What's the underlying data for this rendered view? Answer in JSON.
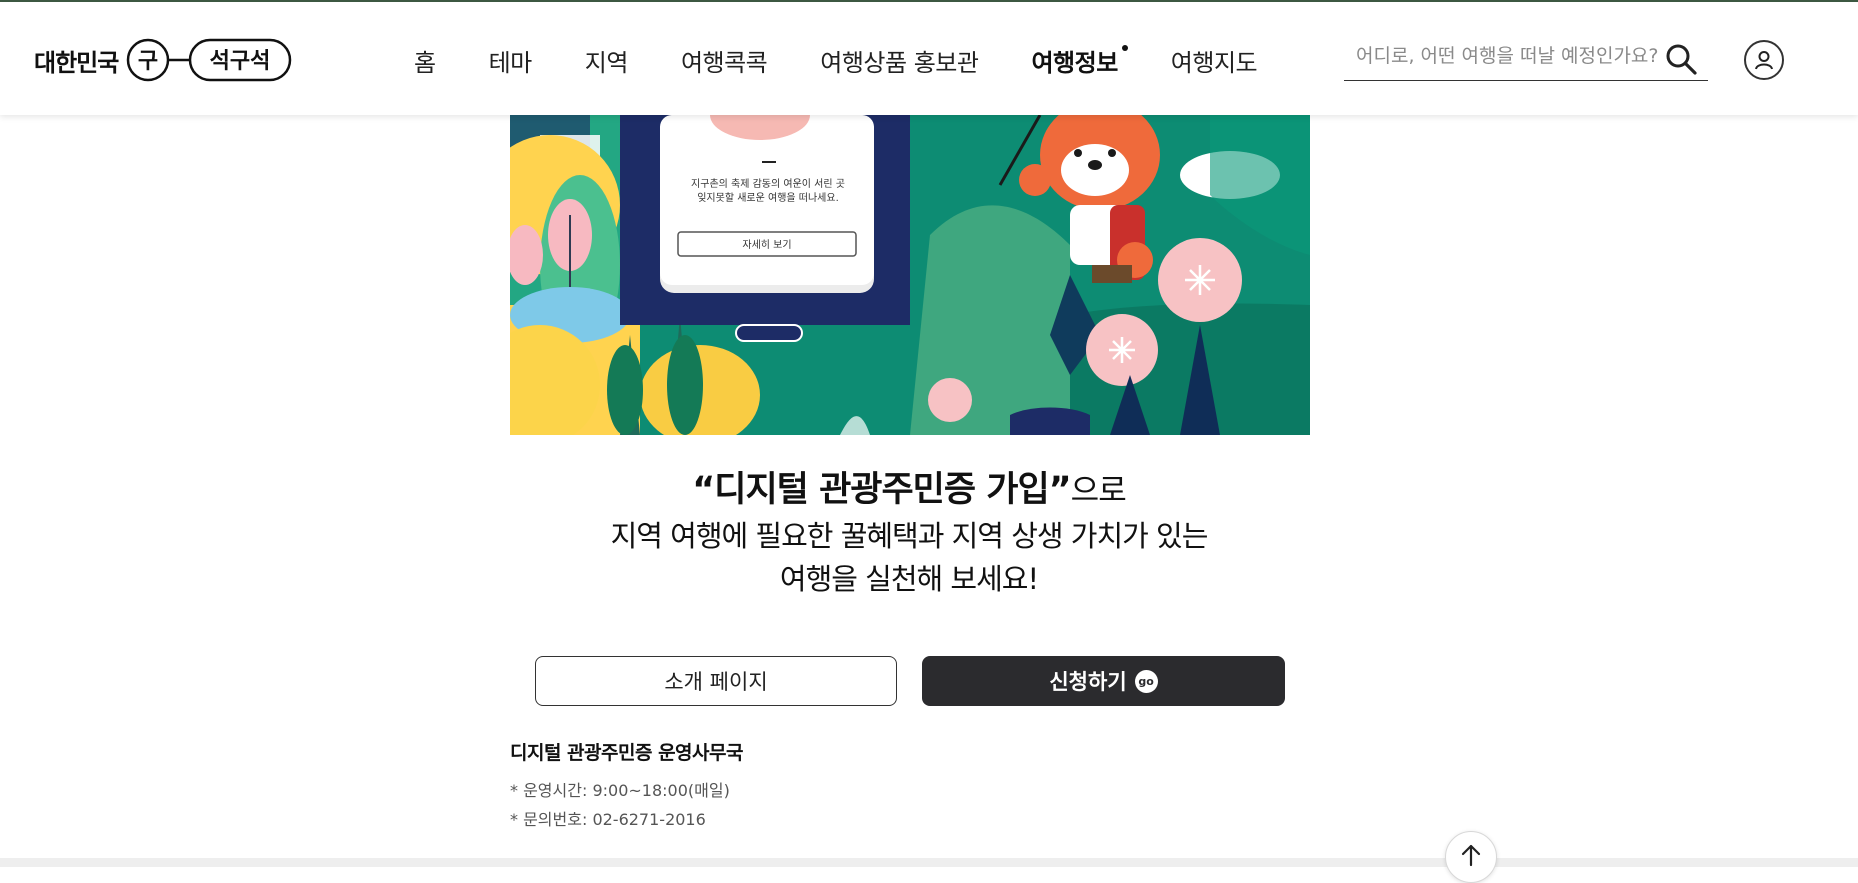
{
  "header": {
    "logo_text": "대한민국",
    "logo_mark_left": "구",
    "logo_mark_right": "석구석",
    "nav": [
      "홈",
      "테마",
      "지역",
      "여행콕콕",
      "여행상품 홍보관",
      "여행정보",
      "여행지도"
    ],
    "active_nav": "여행정보",
    "search_placeholder": "어디로, 어떤 여행을 떠날 예정인가요?"
  },
  "hero": {
    "card_text_line1": "지구촌의 축제 감동의 여운이 서린 곳",
    "card_text_line2": "잊지못할 새로운 여행을 떠나세요.",
    "card_button": "자세히 보기"
  },
  "headline": {
    "strong": "“디지털 관광주민증 가입”",
    "suffix": "으로",
    "line2": "지역 여행에 필요한 꿀혜택과 지역 상생 가치가 있는",
    "line3": "여행을 실천해 보세요!"
  },
  "buttons": {
    "intro": "소개 페이지",
    "apply": "신청하기",
    "apply_badge": "go"
  },
  "info": {
    "title": "디지털 관광주민증 운영사무국",
    "hours": "* 운영시간: 9:00~18:00(매일)",
    "phone": "* 문의번호: 02-6271-2016"
  },
  "colors": {
    "accent_dark": "#2b2b2e",
    "top_line": "#3e5a43",
    "hero_green": "#0b8a72"
  },
  "icons": {
    "search": "search-icon",
    "user": "user-icon",
    "to_top": "arrow-up-icon"
  }
}
